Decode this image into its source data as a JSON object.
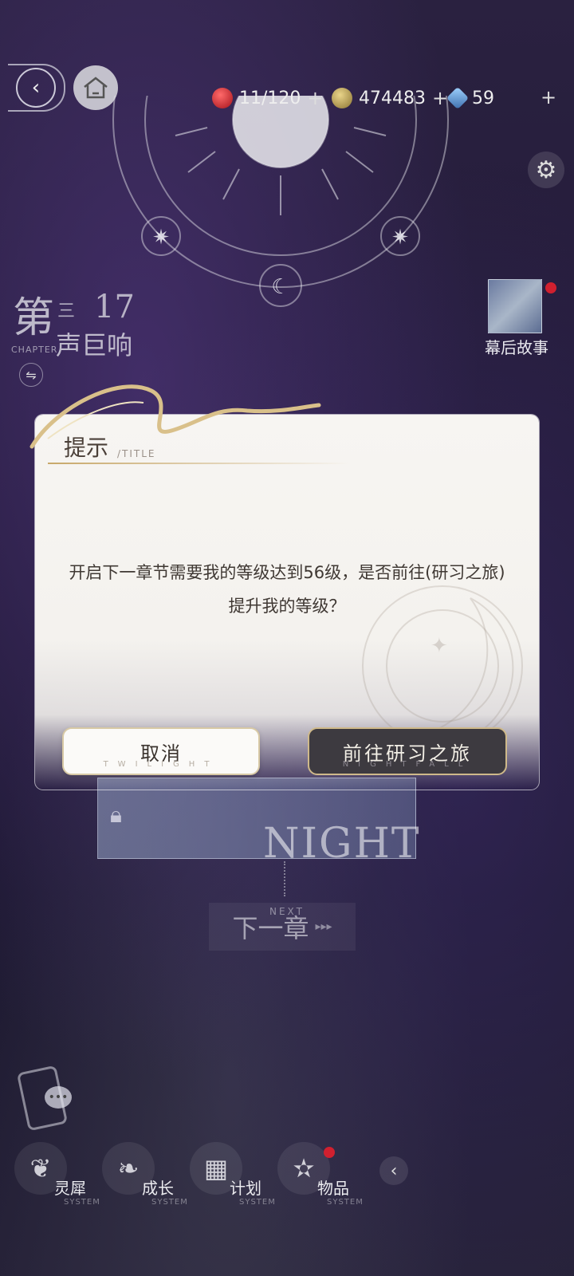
{
  "top_bar": {
    "stamina": "11/120",
    "gold": "474483",
    "diamond": "59",
    "plus": "+"
  },
  "chapter": {
    "prefix": "第",
    "number": "17",
    "small_char": "三",
    "label_en": "CHAPTER",
    "name": "声巨响"
  },
  "side": {
    "story_label": "幕后故事"
  },
  "dialog": {
    "title": "提示",
    "title_en": "/TITLE",
    "message": "开启下一章节需要我的等级达到56级，是否前往(研习之旅)提升我的等级？",
    "cancel_label": "取消",
    "cancel_sub": "TWILIGHT",
    "confirm_label": "前往研习之旅",
    "confirm_sub": "NIGHTFALL"
  },
  "background_cards": {
    "night_text": "NIGHT",
    "next_label": "下一章",
    "next_en": "NEXT"
  },
  "nav": {
    "items": [
      {
        "label": "灵犀",
        "sub": "SYSTEM",
        "icon": "wings-icon"
      },
      {
        "label": "成长",
        "sub": "SYSTEM",
        "icon": "leaf-icon"
      },
      {
        "label": "计划",
        "sub": "SYSTEM",
        "icon": "calendar-icon"
      },
      {
        "label": "物品",
        "sub": "SYSTEM",
        "icon": "star-icon"
      }
    ]
  },
  "colors": {
    "accent_gold": "#c8a86a",
    "badge_red": "#d0202f",
    "confirm_bg": "#3d3a40"
  }
}
